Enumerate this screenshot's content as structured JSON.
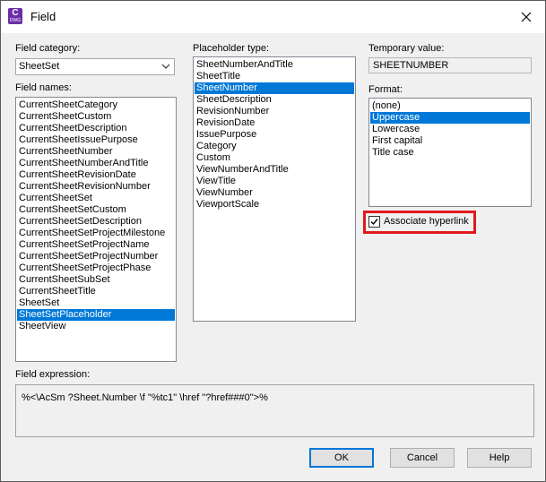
{
  "window": {
    "title": "Field",
    "icon_letter": "C",
    "icon_sub": "DWG"
  },
  "field_category": {
    "label": "Field category:",
    "selected": "SheetSet"
  },
  "field_names": {
    "label": "Field names:",
    "items": [
      "CurrentSheetCategory",
      "CurrentSheetCustom",
      "CurrentSheetDescription",
      "CurrentSheetIssuePurpose",
      "CurrentSheetNumber",
      "CurrentSheetNumberAndTitle",
      "CurrentSheetRevisionDate",
      "CurrentSheetRevisionNumber",
      "CurrentSheetSet",
      "CurrentSheetSetCustom",
      "CurrentSheetSetDescription",
      "CurrentSheetSetProjectMilestone",
      "CurrentSheetSetProjectName",
      "CurrentSheetSetProjectNumber",
      "CurrentSheetSetProjectPhase",
      "CurrentSheetSubSet",
      "CurrentSheetTitle",
      "SheetSet",
      "SheetSetPlaceholder",
      "SheetView"
    ],
    "selected": "SheetSetPlaceholder"
  },
  "placeholder_type": {
    "label": "Placeholder type:",
    "items": [
      "SheetNumberAndTitle",
      "SheetTitle",
      "SheetNumber",
      "SheetDescription",
      "RevisionNumber",
      "RevisionDate",
      "IssuePurpose",
      "Category",
      "Custom",
      "ViewNumberAndTitle",
      "ViewTitle",
      "ViewNumber",
      "ViewportScale"
    ],
    "selected": "SheetNumber"
  },
  "temporary_value": {
    "label": "Temporary value:",
    "value": "SHEETNUMBER"
  },
  "format": {
    "label": "Format:",
    "items": [
      "(none)",
      "Uppercase",
      "Lowercase",
      "First capital",
      "Title case"
    ],
    "selected": "Uppercase"
  },
  "associate_hyperlink": {
    "label": "Associate hyperlink",
    "checked": true
  },
  "field_expression": {
    "label": "Field expression:",
    "value": "%<\\AcSm ?Sheet.Number \\f \"%tc1\" \\href \"?href###0\">%"
  },
  "buttons": {
    "ok": "OK",
    "cancel": "Cancel",
    "help": "Help"
  },
  "colors": {
    "selection": "#0078d7",
    "highlight_box": "#e0191e",
    "icon": "#6a2fa7"
  }
}
